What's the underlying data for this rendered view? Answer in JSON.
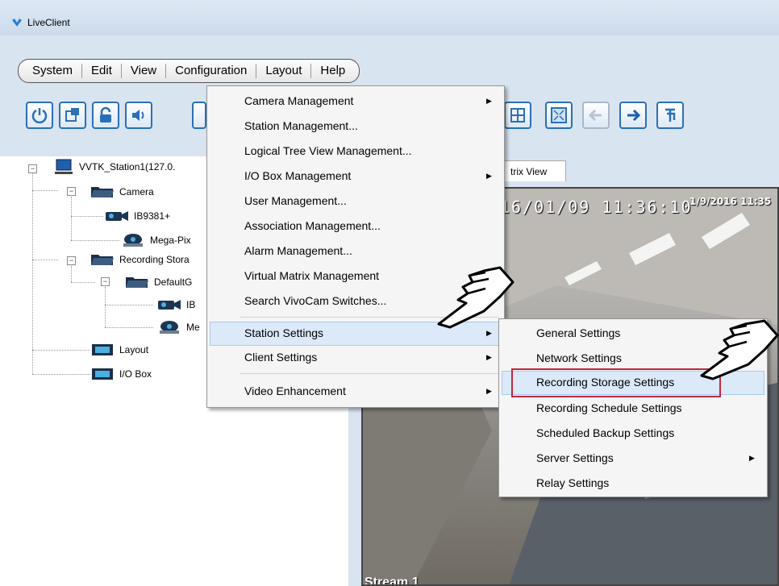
{
  "window": {
    "title": "LiveClient"
  },
  "menubar": [
    "System",
    "Edit",
    "View",
    "Configuration",
    "Layout",
    "Help"
  ],
  "tree": {
    "station": "VVTK_Station1(127.0.",
    "camera_group": "Camera",
    "camera1": "IB9381+",
    "camera2": "Mega-Pix",
    "recording_group": "Recording Stora",
    "default_group": "DefaultG",
    "rec_cam1": "IB",
    "rec_cam2": "Me",
    "layout": "Layout",
    "io_box": "I/O Box"
  },
  "tab": {
    "label": "trix View"
  },
  "video": {
    "osd_time": "16/01/09 11:36:10",
    "osd_time_small": "1/9/2016 11:35",
    "stream_label": "Stream 1"
  },
  "config_menu": {
    "items": [
      "Camera Management",
      "Station Management...",
      "Logical Tree View Management...",
      "I/O Box Management",
      "User Management...",
      "Association Management...",
      "Alarm Management...",
      "Virtual Matrix Management",
      "Search VivoCam Switches...",
      "Station Settings",
      "Client Settings",
      "Video Enhancement"
    ]
  },
  "station_settings_menu": {
    "items": [
      "General Settings",
      "Network Settings",
      "Recording Storage Settings",
      "Recording Schedule Settings",
      "Scheduled Backup Settings",
      "Server Settings",
      "Relay Settings"
    ]
  },
  "colors": {
    "accent": "#2b6fb6",
    "highlight_border": "#c0283c",
    "menu_hover": "#dbe9f9"
  }
}
